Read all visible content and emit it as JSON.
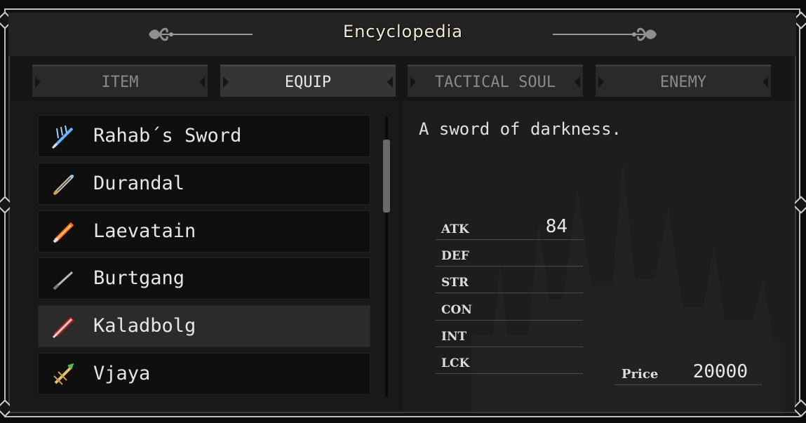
{
  "window": {
    "title": "Encyclopedia"
  },
  "tabs": [
    {
      "label": "ITEM",
      "active": false
    },
    {
      "label": "EQUIP",
      "active": true
    },
    {
      "label": "TACTICAL SOUL",
      "active": false
    },
    {
      "label": "ENEMY",
      "active": false
    }
  ],
  "list": {
    "items": [
      {
        "label": "Rahab´s Sword",
        "icon": "ice-sword-icon",
        "selected": false
      },
      {
        "label": "Durandal",
        "icon": "sword-icon",
        "selected": false
      },
      {
        "label": "Laevatain",
        "icon": "flame-sword-icon",
        "selected": false
      },
      {
        "label": "Burtgang",
        "icon": "sword-icon",
        "selected": false
      },
      {
        "label": "Kaladbolg",
        "icon": "red-sword-icon",
        "selected": true
      },
      {
        "label": "Vjaya",
        "icon": "gold-sword-icon",
        "selected": false
      }
    ],
    "scroll_fraction": 0.25
  },
  "detail": {
    "description": "A sword of darkness.",
    "stats": [
      {
        "key": "ATK",
        "value": "84"
      },
      {
        "key": "DEF",
        "value": ""
      },
      {
        "key": "STR",
        "value": ""
      },
      {
        "key": "CON",
        "value": ""
      },
      {
        "key": "INT",
        "value": ""
      },
      {
        "key": "LCK",
        "value": ""
      }
    ],
    "price_label": "Price",
    "price_value": "20000"
  },
  "colors": {
    "text": "#e6e6e6",
    "dim_tab": "#8a8a8a",
    "title": "#f3ead4",
    "frame": "#bdbdbd"
  }
}
